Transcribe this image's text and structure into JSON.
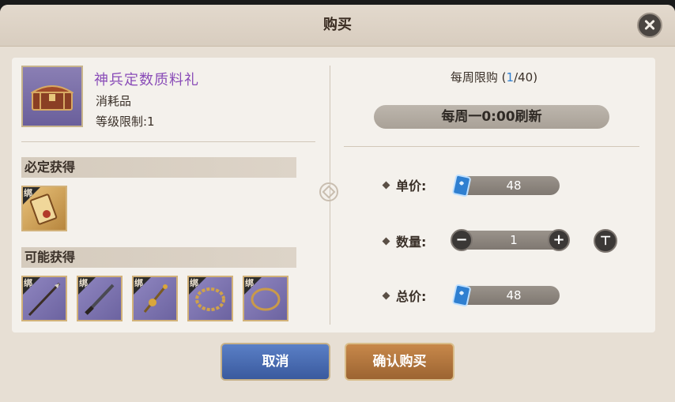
{
  "dialog": {
    "title": "购买"
  },
  "item": {
    "name": "神兵定数质料礼",
    "type": "消耗品",
    "level_limit": "等级限制:1"
  },
  "guaranteed": {
    "header": "必定获得",
    "items": [
      {
        "bind_label": "绑",
        "icon": "scroll-icon"
      }
    ]
  },
  "possible": {
    "header": "可能获得",
    "items": [
      {
        "bind_label": "绑",
        "icon": "spear-icon"
      },
      {
        "bind_label": "绑",
        "icon": "blade-icon"
      },
      {
        "bind_label": "绑",
        "icon": "staff-icon"
      },
      {
        "bind_label": "绑",
        "icon": "thorn-ring-icon"
      },
      {
        "bind_label": "绑",
        "icon": "ring-icon"
      }
    ]
  },
  "limit": {
    "prefix": "每周限购 (",
    "current": "1",
    "suffix": "/40)",
    "refresh": "每周一0:00刷新"
  },
  "price": {
    "unit_label": "单价:",
    "unit_value": "48",
    "qty_label": "数量:",
    "qty_value": "1",
    "max_button": "⊤",
    "total_label": "总价:",
    "total_value": "48"
  },
  "actions": {
    "cancel": "取消",
    "confirm": "确认购买"
  },
  "colors": {
    "item_name": "#8a4db8",
    "limit_current": "#2f7fd0"
  }
}
